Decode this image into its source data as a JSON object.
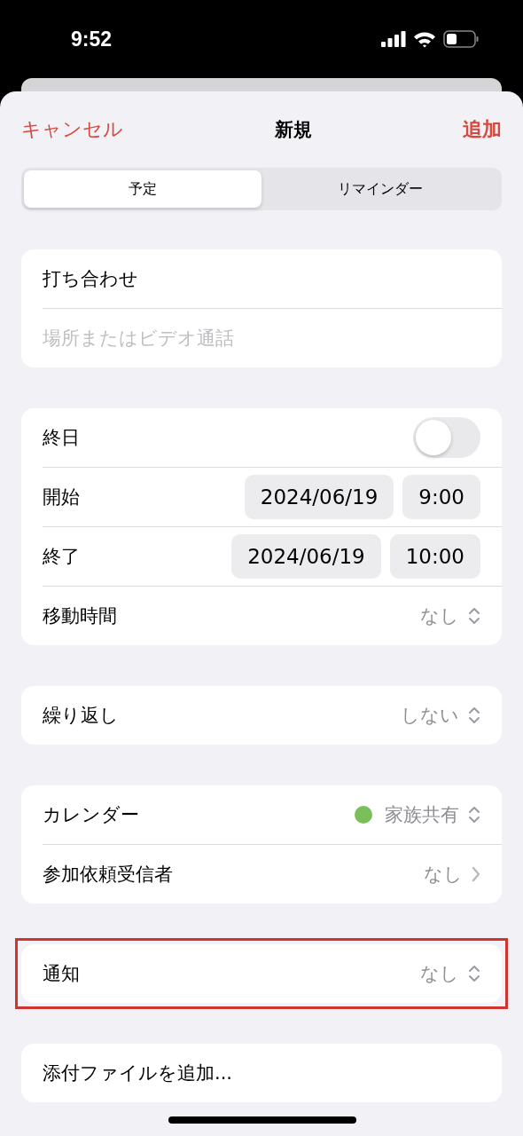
{
  "status_bar": {
    "time": "9:52"
  },
  "nav": {
    "cancel": "キャンセル",
    "title": "新規",
    "add": "追加"
  },
  "segments": [
    {
      "label": "予定",
      "selected": true
    },
    {
      "label": "リマインダー",
      "selected": false
    }
  ],
  "sections": [
    {
      "highlighted": false,
      "rows": [
        {
          "kind": "title",
          "value": "打ち合わせ"
        },
        {
          "kind": "field",
          "placeholder": "場所またはビデオ通話"
        }
      ]
    },
    {
      "highlighted": false,
      "rows": [
        {
          "kind": "toggle",
          "label": "終日",
          "on": false
        },
        {
          "kind": "datetime",
          "label": "開始",
          "date": "2024/06/19",
          "time": "9:00"
        },
        {
          "kind": "datetime",
          "label": "終了",
          "date": "2024/06/19",
          "time": "10:00"
        },
        {
          "kind": "select",
          "label": "移動時間",
          "value": "なし"
        }
      ]
    },
    {
      "highlighted": false,
      "rows": [
        {
          "kind": "select",
          "label": "繰り返し",
          "value": "しない"
        }
      ]
    },
    {
      "highlighted": false,
      "rows": [
        {
          "kind": "select",
          "label": "カレンダー",
          "value": "家族共有",
          "color": "#79bf5a"
        },
        {
          "kind": "disclosure",
          "label": "参加依頼受信者",
          "value": "なし"
        }
      ]
    },
    {
      "highlighted": true,
      "rows": [
        {
          "kind": "select",
          "label": "通知",
          "value": "なし"
        }
      ]
    },
    {
      "highlighted": false,
      "rows": [
        {
          "kind": "action",
          "label": "添付ファイルを追加..."
        }
      ]
    }
  ]
}
